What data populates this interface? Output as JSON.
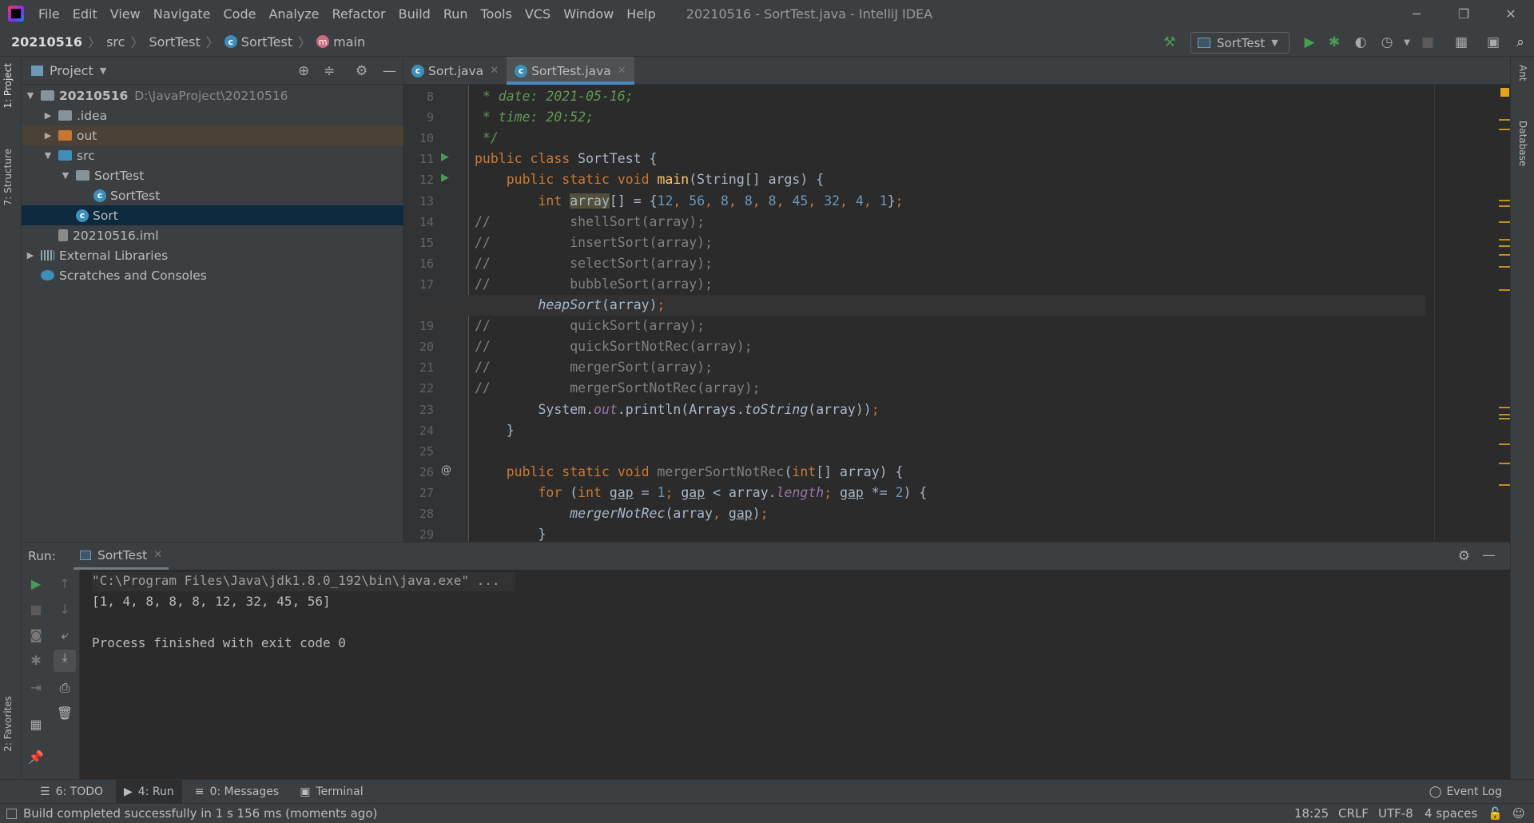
{
  "window": {
    "title": "20210516 - SortTest.java - IntelliJ IDEA",
    "minimize": "─",
    "restore": "❐",
    "close": "✕"
  },
  "menu": [
    "File",
    "Edit",
    "View",
    "Navigate",
    "Code",
    "Analyze",
    "Refactor",
    "Build",
    "Run",
    "Tools",
    "VCS",
    "Window",
    "Help"
  ],
  "breadcrumb": {
    "project": "20210516",
    "src": "src",
    "package": "SortTest",
    "class": "SortTest",
    "method": "main"
  },
  "toolbar": {
    "run_config": "SortTest",
    "icons": [
      "hammer-icon",
      "run-icon",
      "debug-icon",
      "coverage-icon",
      "profile-icon",
      "stop-icon",
      "project-structure-icon",
      "presentation-icon",
      "search-icon"
    ]
  },
  "side_tabs": {
    "left_top": [
      "1: Project",
      "7: Structure"
    ],
    "left_bottom": "2: Favorites",
    "right": [
      "Ant",
      "Database"
    ]
  },
  "project": {
    "title": "Project",
    "tree": [
      {
        "label": "20210516",
        "path": "D:\\JavaProject\\20210516",
        "depth": 0,
        "expanded": true,
        "type": "module"
      },
      {
        "label": ".idea",
        "depth": 1,
        "expanded": false,
        "type": "folder"
      },
      {
        "label": "out",
        "depth": 1,
        "expanded": false,
        "type": "folder-orange",
        "highlight": true
      },
      {
        "label": "src",
        "depth": 1,
        "expanded": true,
        "type": "folder-src"
      },
      {
        "label": "SortTest",
        "depth": 2,
        "expanded": true,
        "type": "package"
      },
      {
        "label": "SortTest",
        "depth": 3,
        "type": "class"
      },
      {
        "label": "Sort",
        "depth": 2,
        "type": "class",
        "selected": true
      },
      {
        "label": "20210516.iml",
        "depth": 1,
        "type": "file"
      },
      {
        "label": "External Libraries",
        "depth": 0,
        "expanded": false,
        "type": "libs"
      },
      {
        "label": "Scratches and Consoles",
        "depth": 0,
        "type": "scratch"
      }
    ]
  },
  "editor": {
    "tabs": [
      {
        "label": "Sort.java",
        "active": false
      },
      {
        "label": "SortTest.java",
        "active": true
      }
    ],
    "current_line": 18,
    "lines": [
      {
        "n": 8,
        "t": [
          [
            "doc",
            " * date: 2021-05-16;"
          ]
        ]
      },
      {
        "n": 9,
        "t": [
          [
            "doc",
            " * time: 20:52;"
          ]
        ]
      },
      {
        "n": 10,
        "t": [
          [
            "doc",
            " */"
          ]
        ]
      },
      {
        "n": 11,
        "g": "run",
        "t": [
          [
            "kw",
            "public class "
          ],
          [
            "pl",
            "SortTest {"
          ]
        ]
      },
      {
        "n": 12,
        "g": "run",
        "t": [
          [
            "pl",
            "    "
          ],
          [
            "kw",
            "public static void "
          ],
          [
            "fn",
            "main"
          ],
          [
            "pl",
            "(String[] args) {"
          ]
        ]
      },
      {
        "n": 13,
        "t": [
          [
            "pl",
            "        "
          ],
          [
            "kw",
            "int "
          ],
          [
            "sel",
            "array"
          ],
          [
            "pl",
            "[] = {"
          ],
          [
            "num",
            "12"
          ],
          [
            "semi",
            ", "
          ],
          [
            "num",
            "56"
          ],
          [
            "semi",
            ", "
          ],
          [
            "num",
            "8"
          ],
          [
            "semi",
            ", "
          ],
          [
            "num",
            "8"
          ],
          [
            "semi",
            ", "
          ],
          [
            "num",
            "8"
          ],
          [
            "semi",
            ", "
          ],
          [
            "num",
            "45"
          ],
          [
            "semi",
            ", "
          ],
          [
            "num",
            "32"
          ],
          [
            "semi",
            ", "
          ],
          [
            "num",
            "4"
          ],
          [
            "semi",
            ", "
          ],
          [
            "num",
            "1"
          ],
          [
            "pl",
            "}"
          ],
          [
            "semi",
            ";"
          ]
        ]
      },
      {
        "n": 14,
        "t": [
          [
            "lc",
            "//          shellSort(array);"
          ]
        ]
      },
      {
        "n": 15,
        "t": [
          [
            "lc",
            "//          insertSort(array);"
          ]
        ]
      },
      {
        "n": 16,
        "t": [
          [
            "lc",
            "//          selectSort(array);"
          ]
        ]
      },
      {
        "n": 17,
        "t": [
          [
            "lc",
            "//          bubbleSort(array);"
          ]
        ]
      },
      {
        "n": 18,
        "t": [
          [
            "pl",
            "        "
          ],
          [
            "it",
            "heapSort"
          ],
          [
            "pl",
            "(array)"
          ],
          [
            "semi",
            ";"
          ]
        ]
      },
      {
        "n": 19,
        "t": [
          [
            "lc",
            "//          quickSort(array);"
          ]
        ]
      },
      {
        "n": 20,
        "t": [
          [
            "lc",
            "//          quickSortNotRec(array);"
          ]
        ]
      },
      {
        "n": 21,
        "t": [
          [
            "lc",
            "//          mergerSort(array);"
          ]
        ]
      },
      {
        "n": 22,
        "t": [
          [
            "lc",
            "//          mergerSortNotRec(array);"
          ]
        ]
      },
      {
        "n": 23,
        "t": [
          [
            "pl",
            "        System."
          ],
          [
            "fld",
            "out"
          ],
          [
            "pl",
            ".println(Arrays."
          ],
          [
            "it",
            "toString"
          ],
          [
            "pl",
            "(array))"
          ],
          [
            "semi",
            ";"
          ]
        ]
      },
      {
        "n": 24,
        "t": [
          [
            "pl",
            "    }"
          ]
        ]
      },
      {
        "n": 25,
        "t": []
      },
      {
        "n": 26,
        "g": "@",
        "t": [
          [
            "pl",
            "    "
          ],
          [
            "kw",
            "public static void "
          ],
          [
            "un",
            "mergerSortNotRec"
          ],
          [
            "pl",
            "("
          ],
          [
            "kw",
            "int"
          ],
          [
            "pl",
            "[] array) {"
          ]
        ]
      },
      {
        "n": 27,
        "t": [
          [
            "pl",
            "        "
          ],
          [
            "kw",
            "for "
          ],
          [
            "pl",
            "("
          ],
          [
            "kw",
            "int "
          ],
          [
            "ul",
            "gap"
          ],
          [
            "pl",
            " = "
          ],
          [
            "num",
            "1"
          ],
          [
            "semi",
            "; "
          ],
          [
            "ul",
            "gap"
          ],
          [
            "pl",
            " < array."
          ],
          [
            "fld",
            "length"
          ],
          [
            "semi",
            "; "
          ],
          [
            "ul",
            "gap"
          ],
          [
            "pl",
            " *= "
          ],
          [
            "num",
            "2"
          ],
          [
            "pl",
            ") {"
          ]
        ]
      },
      {
        "n": 28,
        "t": [
          [
            "pl",
            "            "
          ],
          [
            "it",
            "mergerNotRec"
          ],
          [
            "pl",
            "(array"
          ],
          [
            "semi",
            ", "
          ],
          [
            "ul",
            "gap"
          ],
          [
            "pl",
            ")"
          ],
          [
            "semi",
            ";"
          ]
        ]
      },
      {
        "n": 29,
        "t": [
          [
            "pl",
            "        }"
          ]
        ]
      }
    ]
  },
  "run": {
    "label": "Run:",
    "tab": "SortTest",
    "console": [
      "\"C:\\Program Files\\Java\\jdk1.8.0_192\\bin\\java.exe\" ...",
      "[1, 4, 8, 8, 8, 12, 32, 45, 56]",
      "",
      "Process finished with exit code 0"
    ]
  },
  "bottom_tabs": [
    {
      "label": "6: TODO",
      "icon": "todo-icon"
    },
    {
      "label": "4: Run",
      "icon": "run-icon",
      "active": true
    },
    {
      "label": "0: Messages",
      "icon": "messages-icon"
    },
    {
      "label": "Terminal",
      "icon": "terminal-icon"
    }
  ],
  "event_log": "Event Log",
  "status": {
    "message": "Build completed successfully in 1 s 156 ms (moments ago)",
    "position": "18:25",
    "line_sep": "CRLF",
    "encoding": "UTF-8",
    "indent": "4 spaces"
  },
  "colors": {
    "accent": "#4a88c7",
    "keyword": "#cc7832",
    "doc_comment": "#629755",
    "number": "#6897bb",
    "method": "#ffc66d",
    "run_green": "#499c54",
    "warning_mark": "#bf8f21"
  }
}
